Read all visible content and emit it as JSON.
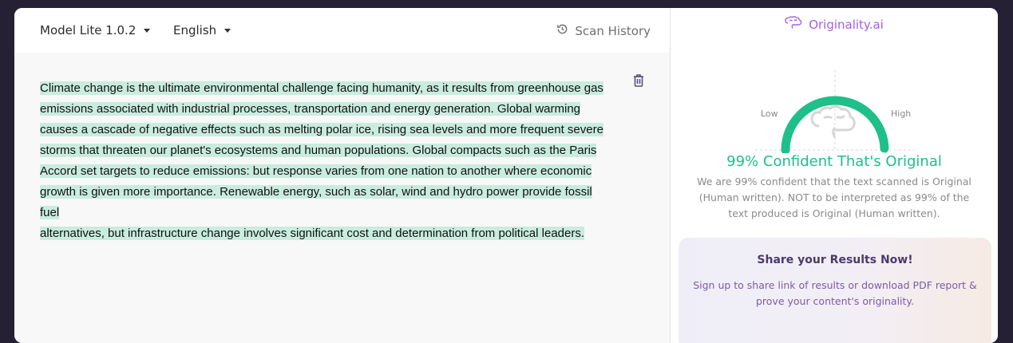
{
  "toolbar": {
    "model_label": "Model Lite 1.0.2",
    "language_label": "English",
    "scan_history_label": "Scan History"
  },
  "editor": {
    "lines": [
      "Climate change is the ultimate environmental challenge facing humanity, as it results from greenhouse gas",
      "emissions associated with industrial processes, transportation and energy generation. Global warming",
      "causes a cascade of negative effects such as melting polar ice, rising sea levels and more frequent severe",
      "storms that threaten our planet's ecosystems and human populations. Global compacts such as the Paris",
      "Accord set targets to reduce emissions: but response varies from one nation to another where economic",
      "growth is given more importance. Renewable energy, such as solar, wind and hydro power provide fossil fuel",
      "alternatives, but infrastructure change involves significant cost and determination from political leaders."
    ],
    "highlight_color": "#c9ecdf"
  },
  "results": {
    "brand": "Originality.ai",
    "gauge_low_label": "Low",
    "gauge_high_label": "High",
    "gauge_value_percent": 99,
    "gauge_color": "#1fbf8a",
    "confidence_text": "99% Confident That's Original",
    "description": "We are 99% confident that the text scanned is Original (Human written). NOT to be interpreted as 99% of the text produced is Original (Human written).",
    "share_title": "Share your Results Now!",
    "share_description": "Sign up to share link of results or download PDF report & prove your content's originality."
  },
  "icons": {
    "scan_history": "history-icon",
    "trash": "trash-icon",
    "brand": "brain-icon",
    "gauge_center": "brain-icon"
  },
  "colors": {
    "accent_purple": "#a35ee8",
    "accent_green": "#1fbf8a",
    "background": "#262035"
  }
}
